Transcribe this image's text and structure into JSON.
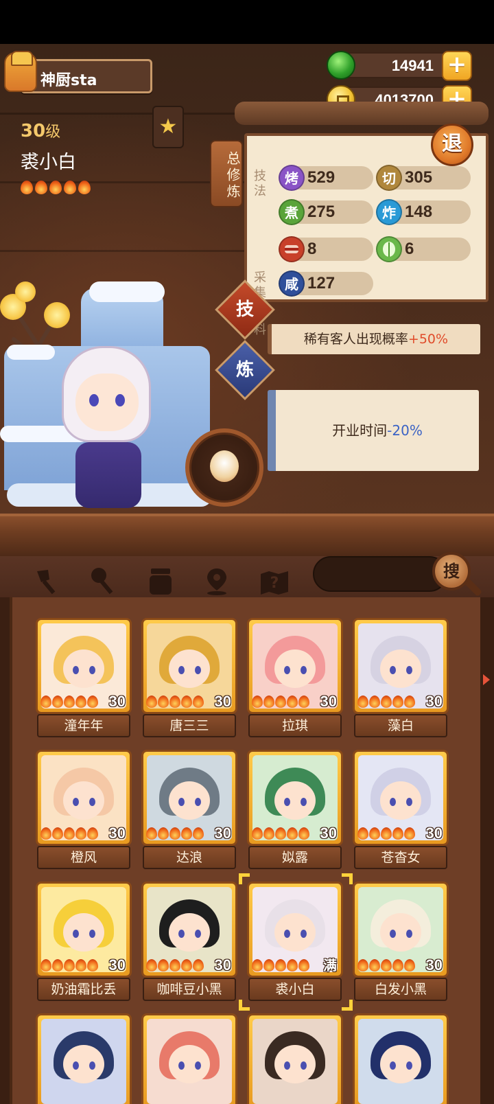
{
  "player": {
    "name": "神厨sta"
  },
  "currency": {
    "jade": "14941",
    "coins": "4013700"
  },
  "selected": {
    "level": "30",
    "level_unit": "级",
    "name": "裘小白"
  },
  "panel": {
    "tab_label": "总修炼",
    "retreat_label": "退",
    "categories": {
      "technique": "技法",
      "gather": "采集",
      "seasoning": "调料"
    },
    "stats": [
      {
        "icon": "烤",
        "value": "529",
        "color": "#8a54c6"
      },
      {
        "icon": "切",
        "value": "305",
        "color": "#b0873c"
      },
      {
        "icon": "煮",
        "value": "275",
        "color": "#5aa43a"
      },
      {
        "icon": "炸",
        "value": "148",
        "color": "#2a9ad6"
      },
      {
        "icon": "meat-icon",
        "value": "8",
        "color": "#c8402a"
      },
      {
        "icon": "cabbage-icon",
        "value": "6",
        "color": "#6ab84a"
      },
      {
        "icon": "咸",
        "value": "127",
        "color": "#2f4f9a"
      }
    ],
    "skill_button": "技",
    "train_button": "炼",
    "banner_text": "稀有客人出现概率",
    "banner_value": "+50%",
    "notice_text": "开业时间",
    "notice_value": "-20%"
  },
  "toolbar": {
    "icons": [
      "spatula-icon",
      "ladle-icon",
      "jar-icon",
      "location-pin-icon",
      "map-question-icon"
    ],
    "search_label": "搜"
  },
  "characters": [
    {
      "name": "潼年年",
      "level": "30",
      "bg": "#fbe9d8",
      "hair": "#f4c35a"
    },
    {
      "name": "唐三三",
      "level": "30",
      "bg": "#f6d79a",
      "hair": "#e0a93a"
    },
    {
      "name": "拉琪",
      "level": "30",
      "bg": "#f8d0c8",
      "hair": "#f39a9a"
    },
    {
      "name": "藻白",
      "level": "30",
      "bg": "#e6e2ee",
      "hair": "#d6d2e2"
    },
    {
      "name": "橙风",
      "level": "30",
      "bg": "#fbe2c4",
      "hair": "#f5c8a6"
    },
    {
      "name": "达浪",
      "level": "30",
      "bg": "#cfd9e0",
      "hair": "#6f7b86"
    },
    {
      "name": "姒露",
      "level": "30",
      "bg": "#d6ecd0",
      "hair": "#3e8a56"
    },
    {
      "name": "苍杳女",
      "level": "30",
      "bg": "#e4e6f4",
      "hair": "#d0d0e6"
    },
    {
      "name": "奶油霜比丢",
      "level": "30",
      "bg": "#fdeaa0",
      "hair": "#f6cf3a"
    },
    {
      "name": "咖啡豆小黑",
      "level": "30",
      "bg": "#e8e4c8",
      "hair": "#1e1e1e"
    },
    {
      "name": "裘小白",
      "level": "满",
      "bg": "#f2e8f0",
      "hair": "#e8e0e8"
    },
    {
      "name": "白发小黑",
      "level": "30",
      "bg": "#d8ecd0",
      "hair": "#f4eedc"
    },
    {
      "name": "",
      "level": "",
      "bg": "#cfd6ee",
      "hair": "#2a3a6a"
    },
    {
      "name": "",
      "level": "",
      "bg": "#f6dcd0",
      "hair": "#e87a6a"
    },
    {
      "name": "",
      "level": "",
      "bg": "#ead6c8",
      "hair": "#3a2a22"
    },
    {
      "name": "",
      "level": "",
      "bg": "#d0dcec",
      "hair": "#22306a"
    }
  ]
}
